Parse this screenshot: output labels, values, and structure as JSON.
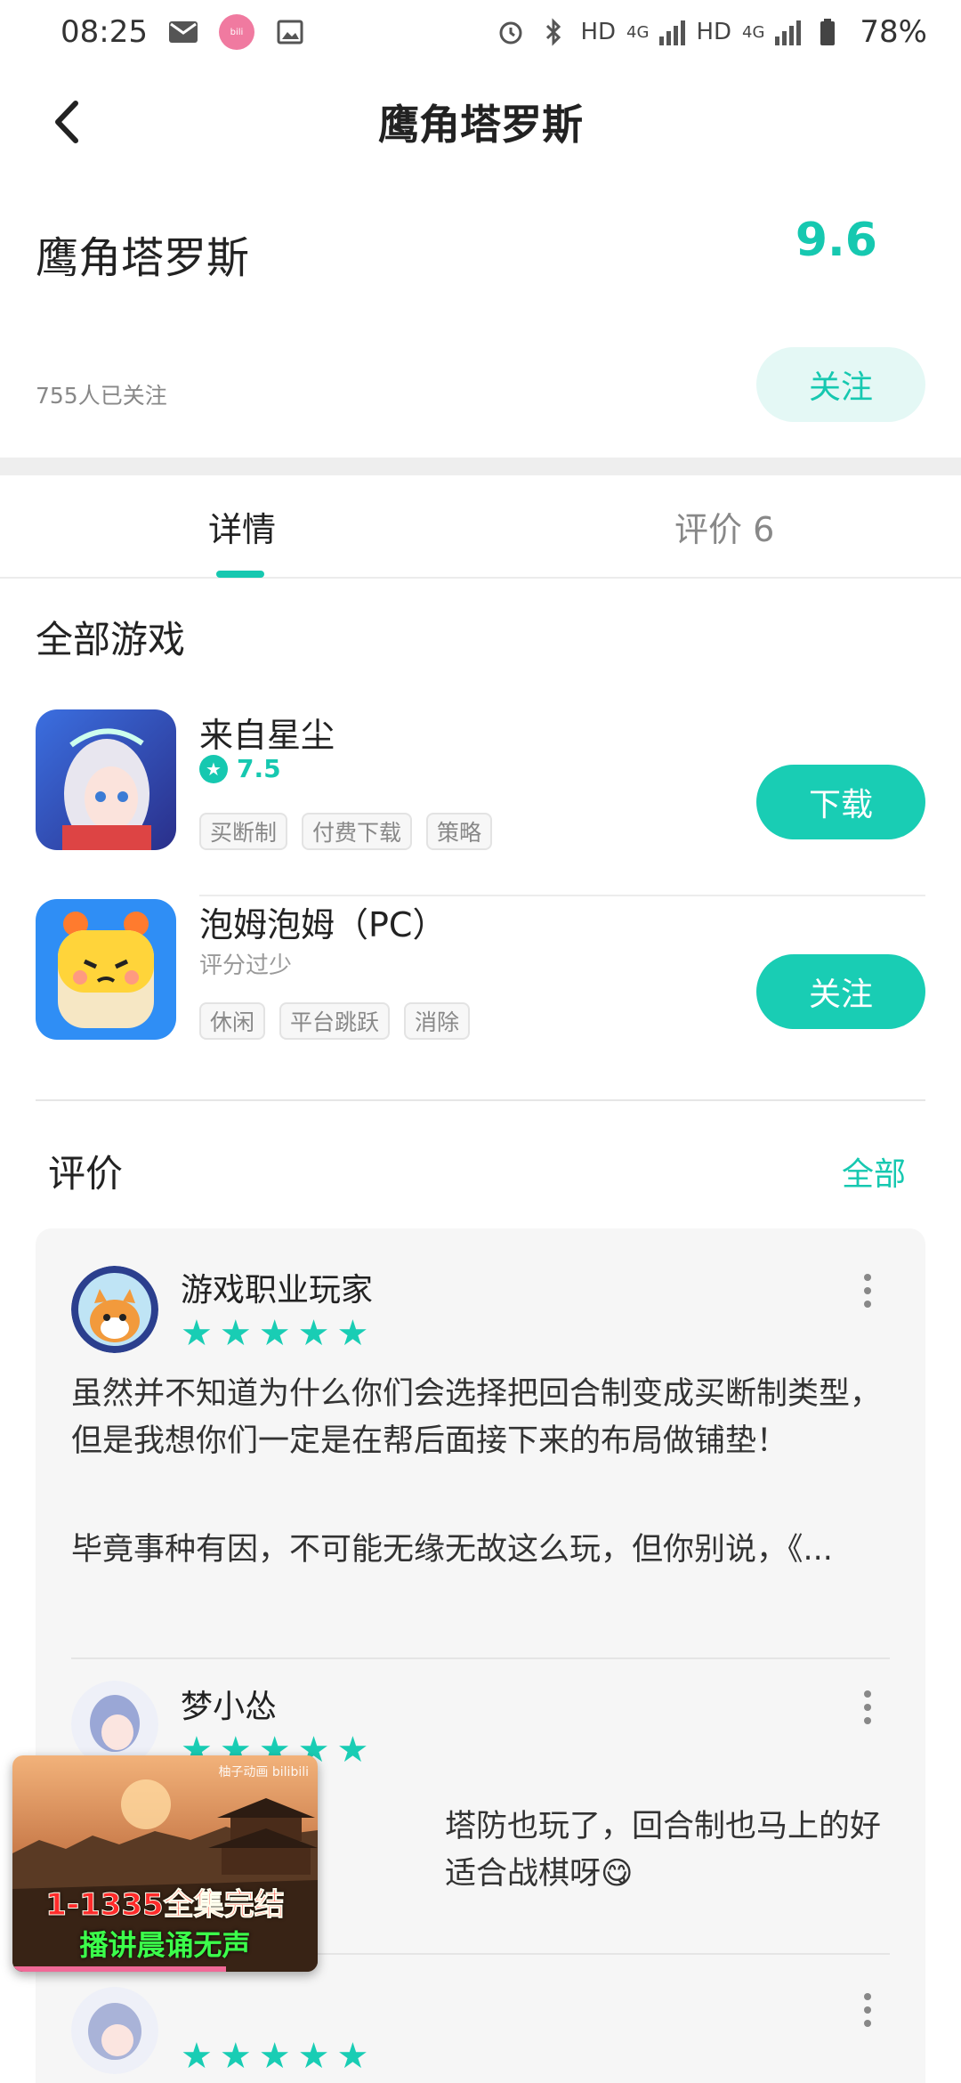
{
  "status_bar": {
    "time": "08:25",
    "network_label_1": "HD",
    "network_type_1": "4G",
    "network_label_2": "HD",
    "network_type_2": "4G",
    "battery": "78%"
  },
  "topbar": {
    "title": "鹰角塔罗斯"
  },
  "header": {
    "tag_title": "鹰角塔罗斯",
    "score": "9.6",
    "followers": "755人已关注",
    "follow_label": "关注"
  },
  "tabs": [
    {
      "label": "详情",
      "active": true
    },
    {
      "label": "评价 6",
      "active": false
    }
  ],
  "games_section": {
    "title": "全部游戏",
    "games": [
      {
        "name": "来自星尘",
        "rating": "7.5",
        "tags": [
          "买断制",
          "付费下载",
          "策略"
        ],
        "action_label": "下载"
      },
      {
        "name": "泡姆泡姆（PC）",
        "rating_text": "评分过少",
        "tags": [
          "休闲",
          "平台跳跃",
          "消除"
        ],
        "action_label": "关注"
      }
    ]
  },
  "reviews_section": {
    "title": "评价",
    "all_label": "全部",
    "reviews": [
      {
        "user": "游戏职业玩家",
        "stars": 5,
        "paragraph_1": "虽然并不知道为什么你们会选择把回合制变成买断制类型，但是我想你们一定是在帮后面接下来的布局做铺垫！",
        "paragraph_2": "毕竟事种有因，不可能无缘无故这么玩，但你别说，《..."
      },
      {
        "user": "梦小怂",
        "stars": 5,
        "text": "塔防也玩了，回合制也马上的好适合战棋呀😋"
      },
      {
        "user": "",
        "stars": 5
      }
    ]
  },
  "pip_video": {
    "badge": "柚子动画 bilibili",
    "line_1": "1-1335全集完结",
    "line_2": "播讲晨诵无声",
    "progress": 0.7
  },
  "colors": {
    "accent": "#16c8b0",
    "button": "#19cdb4",
    "follow_bg": "#e4f8f5"
  }
}
